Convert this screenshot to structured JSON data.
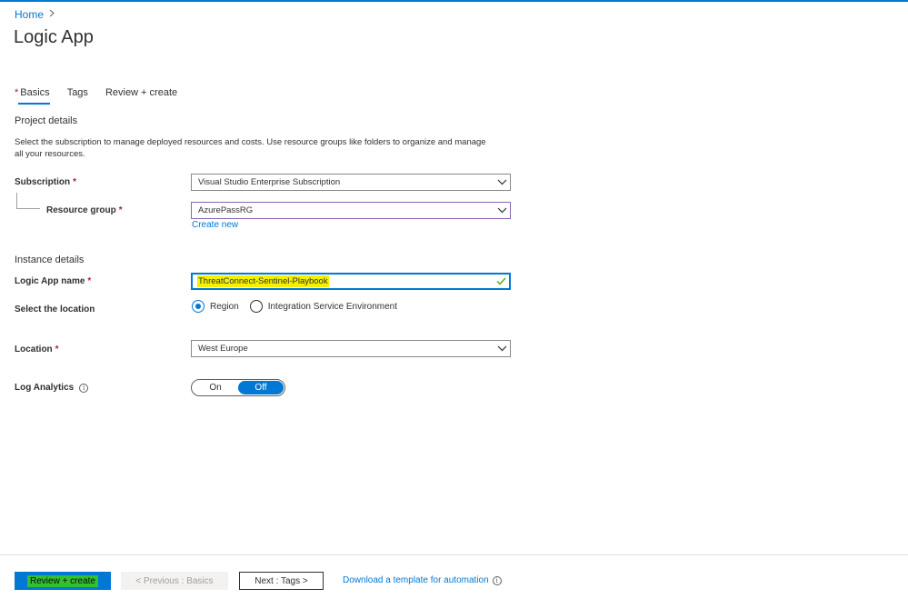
{
  "breadcrumb": {
    "home": "Home"
  },
  "page": {
    "title": "Logic App"
  },
  "tabs": [
    {
      "label": "Basics",
      "required": "*"
    },
    {
      "label": "Tags"
    },
    {
      "label": "Review + create"
    }
  ],
  "project": {
    "title": "Project details",
    "description": "Select the subscription to manage deployed resources and costs. Use resource groups like folders to organize and manage all your resources.",
    "subscription_label": "Subscription",
    "subscription_value": "Visual Studio Enterprise Subscription",
    "resource_group_label": "Resource group",
    "resource_group_value": "AzurePassRG",
    "create_new": "Create new",
    "required_mark": "*"
  },
  "instance": {
    "title": "Instance details",
    "name_label": "Logic App name",
    "name_value": "ThreatConnect-Sentinel-Playbook",
    "location_select_label": "Select the location",
    "radio_options": [
      "Region",
      "Integration Service Environment"
    ],
    "location_label": "Location",
    "location_value": "West Europe",
    "log_analytics_label": "Log Analytics",
    "toggle_on": "On",
    "toggle_off": "Off"
  },
  "footer": {
    "review_create": "Review + create",
    "previous": "< Previous : Basics",
    "next": "Next : Tags >",
    "download_link": "Download a template for automation"
  },
  "colors": {
    "accent": "#0078d4",
    "required": "#a4262c",
    "highlight": "#f4f000",
    "button_highlight": "#30c030"
  },
  "icons": [
    "chevron-right-icon",
    "chevron-down-icon",
    "checkmark-icon",
    "info-icon"
  ]
}
